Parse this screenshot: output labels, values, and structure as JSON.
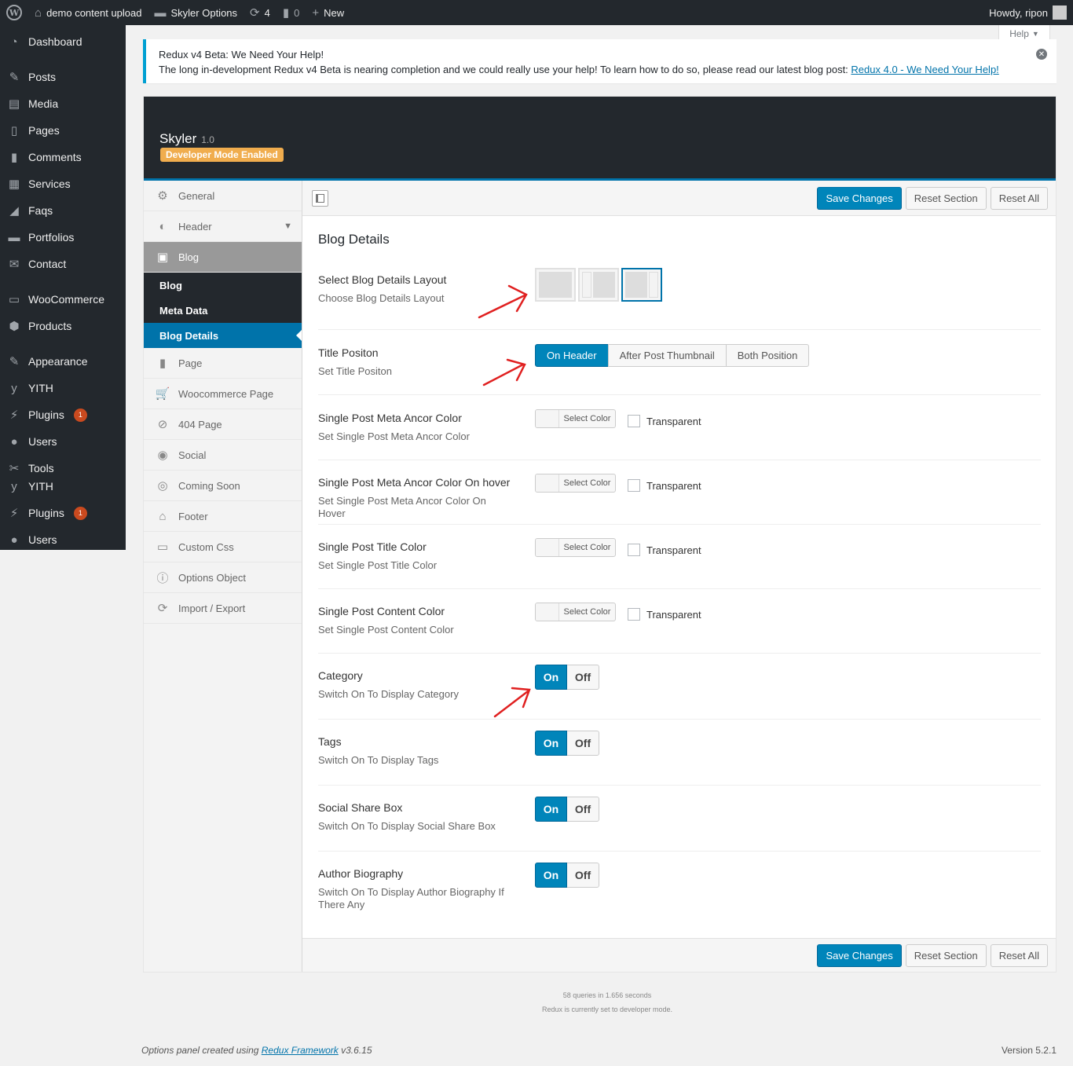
{
  "adminbar": {
    "site_name": "demo content upload",
    "options_name": "Skyler Options",
    "updates_count": "4",
    "comments_count": "0",
    "new_label": "New",
    "howdy": "Howdy, ripon"
  },
  "menu": {
    "items": [
      {
        "label": "Dashboard",
        "icon": "dashboard-icon"
      },
      {
        "label": "Posts",
        "icon": "pin-icon"
      },
      {
        "label": "Media",
        "icon": "media-icon"
      },
      {
        "label": "Pages",
        "icon": "pages-icon"
      },
      {
        "label": "Comments",
        "icon": "comments-icon"
      },
      {
        "label": "Services",
        "icon": "grid-icon"
      },
      {
        "label": "Faqs",
        "icon": "chart-icon"
      },
      {
        "label": "Portfolios",
        "icon": "folder-icon"
      },
      {
        "label": "Contact",
        "icon": "mail-icon"
      },
      {
        "label": "WooCommerce",
        "icon": "woo-icon"
      },
      {
        "label": "Products",
        "icon": "box-icon"
      },
      {
        "label": "Appearance",
        "icon": "brush-icon"
      },
      {
        "label": "YITH",
        "icon": "yith-icon"
      },
      {
        "label": "Plugins",
        "icon": "plug-icon",
        "badge": "1"
      },
      {
        "label": "Users",
        "icon": "user-icon"
      },
      {
        "label": "Tools",
        "icon": "wrench-icon"
      },
      {
        "label": "YITH",
        "icon": "yith-icon"
      },
      {
        "label": "Plugins",
        "icon": "plug-icon",
        "badge": "1"
      },
      {
        "label": "Users",
        "icon": "user-icon"
      }
    ]
  },
  "help_tab": "Help",
  "notice": {
    "title": "Redux v4 Beta: We Need Your Help!",
    "body": "The long in-development Redux v4 Beta is nearing completion and we could really use your help! To learn how to do so, please read our latest blog post: ",
    "link": "Redux 4.0 - We Need Your Help!"
  },
  "panel": {
    "title": "Skyler",
    "version": "1.0",
    "dev_badge": "Developer Mode Enabled"
  },
  "sidebar": {
    "general": "General",
    "header": "Header",
    "blog": "Blog",
    "sub": [
      "Blog",
      "Meta Data",
      "Blog Details"
    ],
    "after": [
      {
        "label": "Page",
        "icon": "page-icon"
      },
      {
        "label": "Woocommerce Page",
        "icon": "cart-icon"
      },
      {
        "label": "404 Page",
        "icon": "ban-icon"
      },
      {
        "label": "Social",
        "icon": "globe-icon"
      },
      {
        "label": "Coming Soon",
        "icon": "compass-icon"
      },
      {
        "label": "Footer",
        "icon": "home-icon"
      },
      {
        "label": "Custom Css",
        "icon": "css-icon"
      },
      {
        "label": "Options Object",
        "icon": "info-icon"
      },
      {
        "label": "Import / Export",
        "icon": "refresh-icon"
      }
    ]
  },
  "actions": {
    "save": "Save Changes",
    "reset_section": "Reset Section",
    "reset_all": "Reset All"
  },
  "section": {
    "title": "Blog Details",
    "layout": {
      "label": "Select Blog Details Layout",
      "desc": "Choose Blog Details Layout",
      "selected": 3
    },
    "title_pos": {
      "label": "Title Positon",
      "desc": "Set Title Positon",
      "options": [
        "On Header",
        "After Post Thumbnail",
        "Both Position"
      ],
      "selected": "On Header"
    },
    "colors": [
      {
        "label": "Single Post Meta Ancor Color",
        "desc": "Set Single Post Meta Ancor Color"
      },
      {
        "label": "Single Post Meta Ancor Color On hover",
        "desc": "Set Single Post Meta Ancor Color On Hover"
      },
      {
        "label": "Single Post Title Color",
        "desc": "Set Single Post Title Color"
      },
      {
        "label": "Single Post Content Color",
        "desc": "Set Single Post Content Color"
      }
    ],
    "select_color": "Select Color",
    "transparent": "Transparent",
    "switches": [
      {
        "label": "Category",
        "desc": "Switch On To Display Category"
      },
      {
        "label": "Tags",
        "desc": "Switch On To Display Tags"
      },
      {
        "label": "Social Share Box",
        "desc": "Switch On To Display Social Share Box"
      },
      {
        "label": "Author Biography",
        "desc": "Switch On To Display Author Biography If There Any"
      }
    ],
    "on": "On",
    "off": "Off"
  },
  "footer": {
    "queries": "58 queries in 1.656 seconds",
    "dev_mode": "Redux is currently set to developer mode.",
    "credit_prefix": "Options panel created using ",
    "credit_link": "Redux Framework",
    "credit_version": " v3.6.15",
    "wp_version": "Version 5.2.1"
  },
  "colors": {
    "accent": "#0085ba",
    "adminbar": "#23282d",
    "badge": "#f0ad4e",
    "arrow": "#e02020"
  }
}
